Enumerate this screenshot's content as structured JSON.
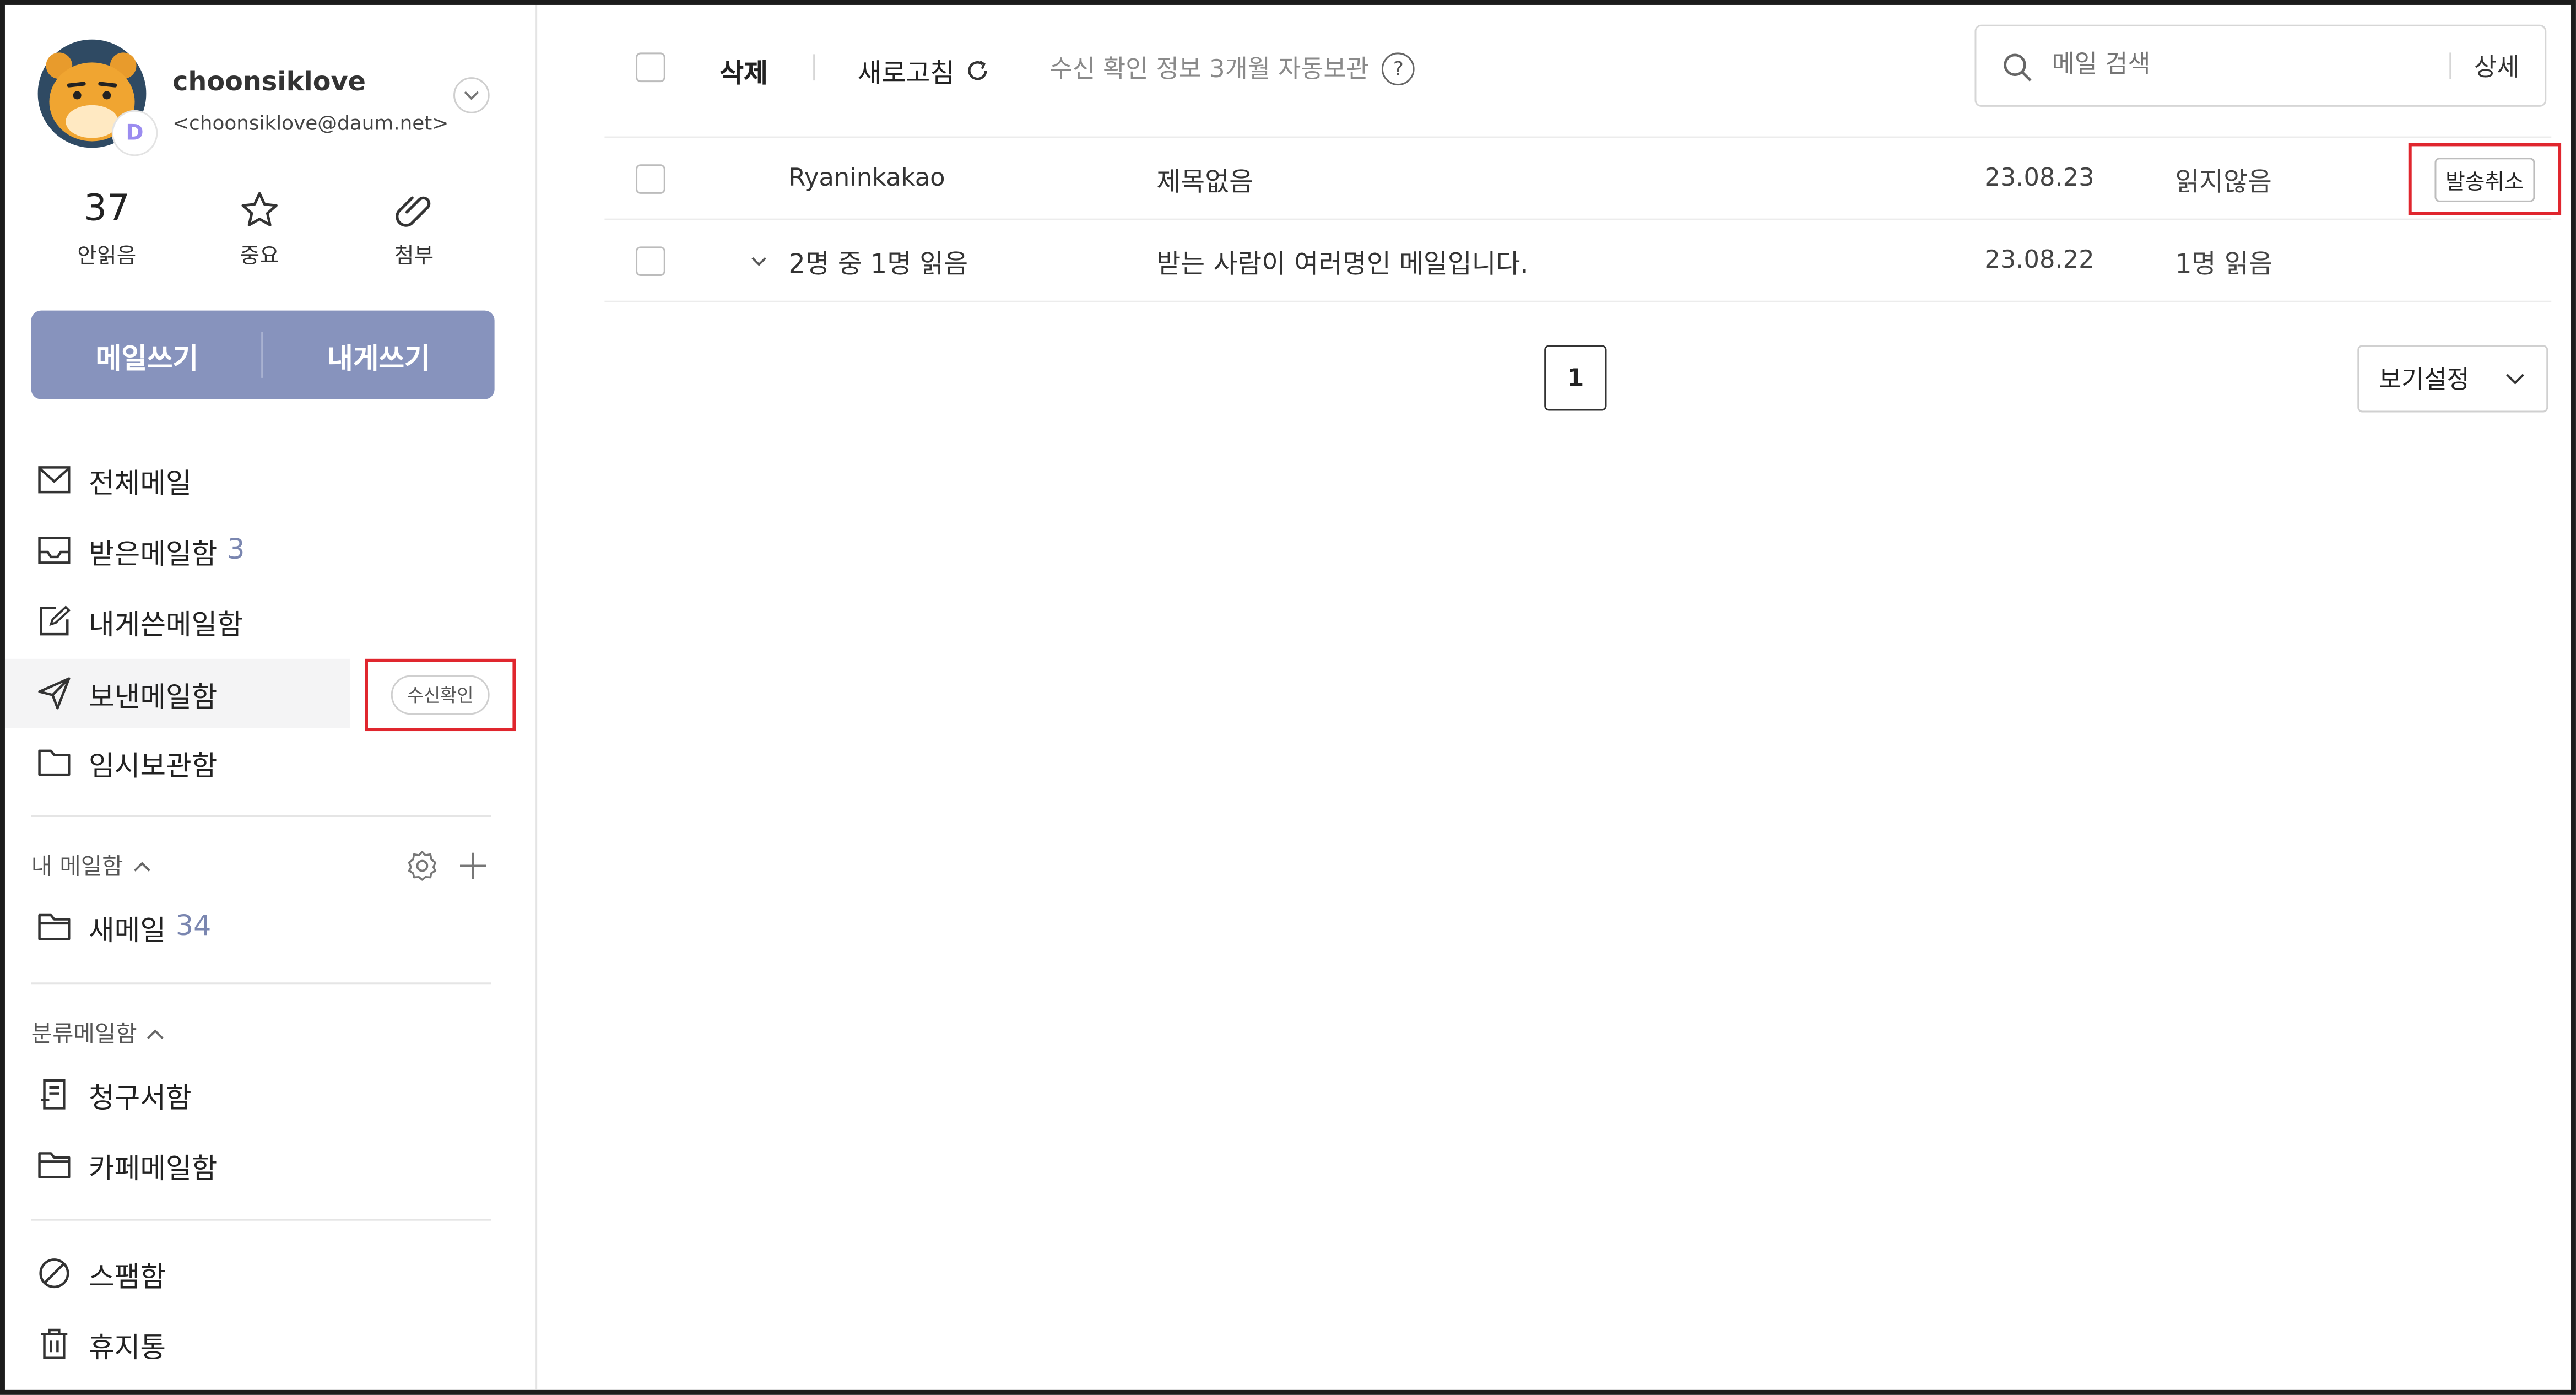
{
  "account": {
    "name": "choonsiklove",
    "email": "<choonsiklove@daum.net>",
    "badge": "D",
    "avatar_icon": "ryan-avatar-icon"
  },
  "stats": [
    {
      "value": "37",
      "label": "안읽음"
    },
    {
      "icon": "star-icon",
      "label": "중요"
    },
    {
      "icon": "paperclip-icon",
      "label": "첨부"
    }
  ],
  "compose": {
    "write": "메일쓰기",
    "self": "내게쓰기"
  },
  "nav": [
    {
      "label": "전체메일",
      "icon": "mail-icon"
    },
    {
      "label": "받은메일함",
      "count": "3",
      "icon": "inbox-icon"
    },
    {
      "label": "내게쓴메일함",
      "icon": "edit-icon"
    },
    {
      "label": "보낸메일함",
      "icon": "send-icon",
      "badge": "수신확인"
    },
    {
      "label": "임시보관함",
      "icon": "folder-icon"
    }
  ],
  "my_mail": {
    "title": "내 메일함",
    "items": [
      {
        "label": "새메일",
        "count": "34",
        "icon": "folder-icon"
      }
    ]
  },
  "category_mail": {
    "title": "분류메일함",
    "items": [
      {
        "label": "청구서함",
        "icon": "bill-icon"
      },
      {
        "label": "카페메일함",
        "icon": "folder-icon"
      }
    ]
  },
  "bottom_nav": [
    {
      "label": "스팸함",
      "icon": "spam-icon"
    },
    {
      "label": "휴지통",
      "icon": "trash-icon"
    }
  ],
  "toolbar": {
    "delete": "삭제",
    "refresh": "새로고침",
    "notice": "수신 확인 정보 3개월 자동보관"
  },
  "search": {
    "placeholder": "메일 검색",
    "detail": "상세"
  },
  "emails": [
    {
      "sender": "Ryaninkakao",
      "subject": "제목없음",
      "date": "23.08.23",
      "status": "읽지않음",
      "action": "발송취소"
    },
    {
      "sender": "2명 중 1명 읽음",
      "subject": "받는 사람이 여러명인 메일입니다.",
      "date": "23.08.22",
      "status": "1명 읽음"
    }
  ],
  "pagination": {
    "current": "1"
  },
  "view_settings": "보기설정",
  "colors": {
    "accent": "#8793bd",
    "highlight": "#e0262e"
  }
}
